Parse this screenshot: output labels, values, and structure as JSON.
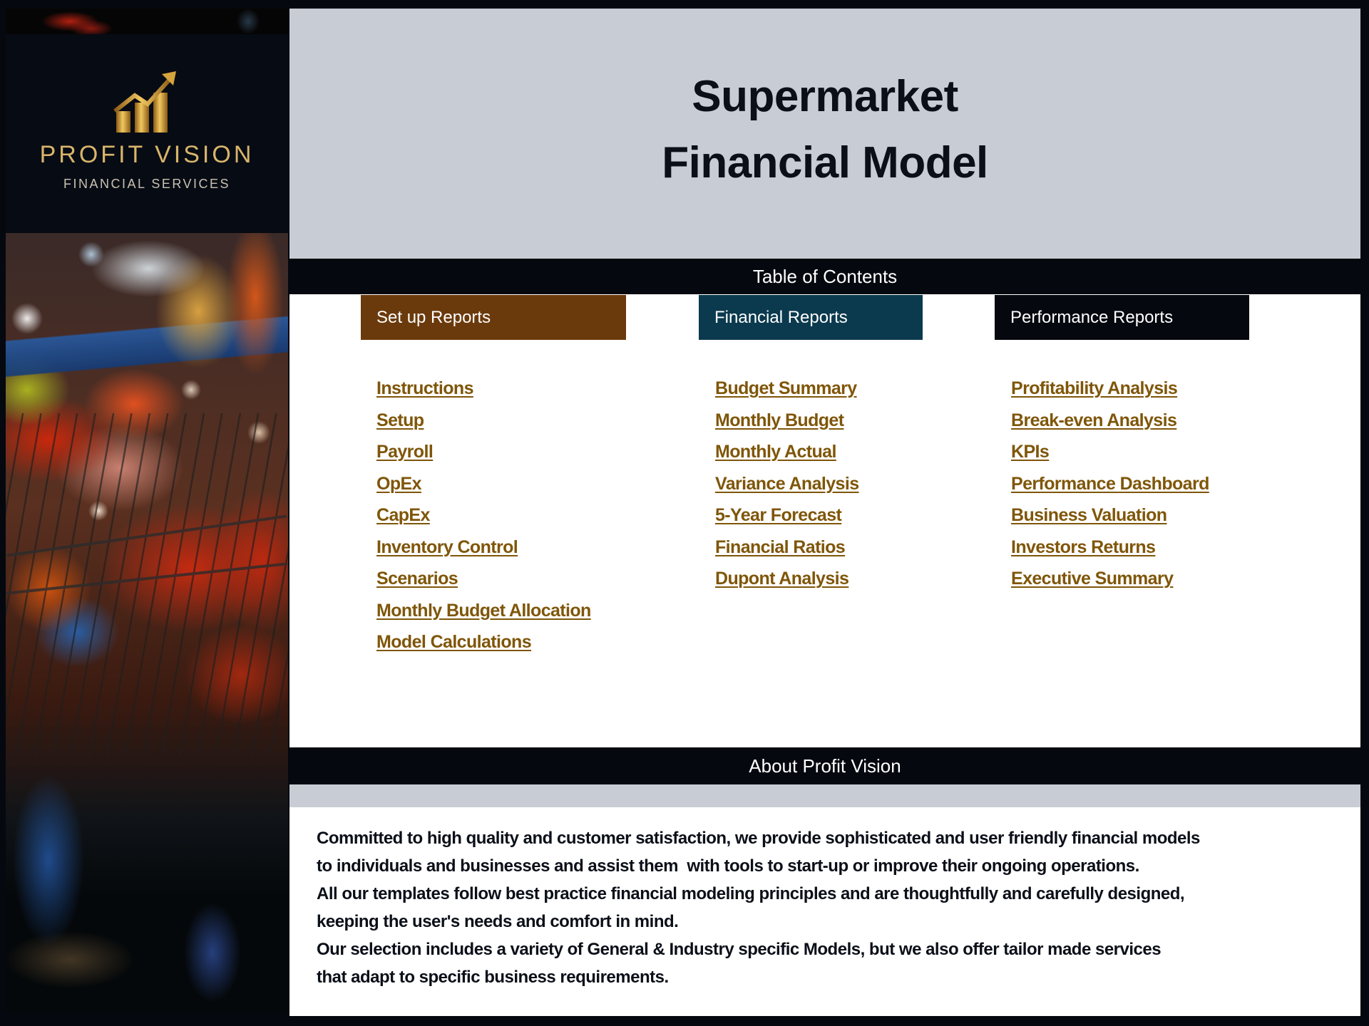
{
  "brand": {
    "logo_icon": "rising-bar-chart-arrow-icon",
    "name": "PROFIT VISION",
    "tagline": "FINANCIAL SERVICES",
    "colors": {
      "gold": "#c8962a",
      "panel": "#070b14"
    }
  },
  "header": {
    "title_line1": "Supermarket",
    "title_line2": "Financial Model",
    "background": "#c8ccd4"
  },
  "toc": {
    "title": "Table of Contents",
    "columns": [
      {
        "heading": "Set up Reports",
        "color": "#6b3a0c",
        "links": [
          "Instructions",
          "Setup",
          "Payroll",
          "OpEx",
          "CapEx",
          "Inventory Control",
          "Scenarios",
          "Monthly Budget Allocation",
          "Model Calculations"
        ]
      },
      {
        "heading": "Financial Reports",
        "color": "#0b3a4e",
        "links": [
          "Budget Summary",
          "Monthly Budget",
          "Monthly Actual",
          "Variance Analysis",
          "5-Year Forecast",
          "Financial Ratios",
          "Dupont Analysis"
        ]
      },
      {
        "heading": "Performance Reports",
        "color": "#05080f",
        "links": [
          "Profitability Analysis",
          "Break-even Analysis",
          "KPIs",
          "Performance Dashboard",
          "Business Valuation",
          "Investors Returns",
          "Executive Summary"
        ]
      }
    ],
    "link_color": "#7f5609"
  },
  "about": {
    "title": "About Profit Vision",
    "lines": [
      "Committed to high quality and customer satisfaction, we provide sophisticated and user friendly financial models",
      "to individuals and businesses and assist them  with tools to start-up or improve their ongoing operations.",
      "All our templates follow best practice financial modeling principles and are thoughtfully and carefully designed,",
      "keeping the user's needs and comfort in mind.",
      "Our selection includes a variety of General & Industry specific Models, but we also offer tailor made services",
      "that adapt to specific business requirements."
    ]
  }
}
